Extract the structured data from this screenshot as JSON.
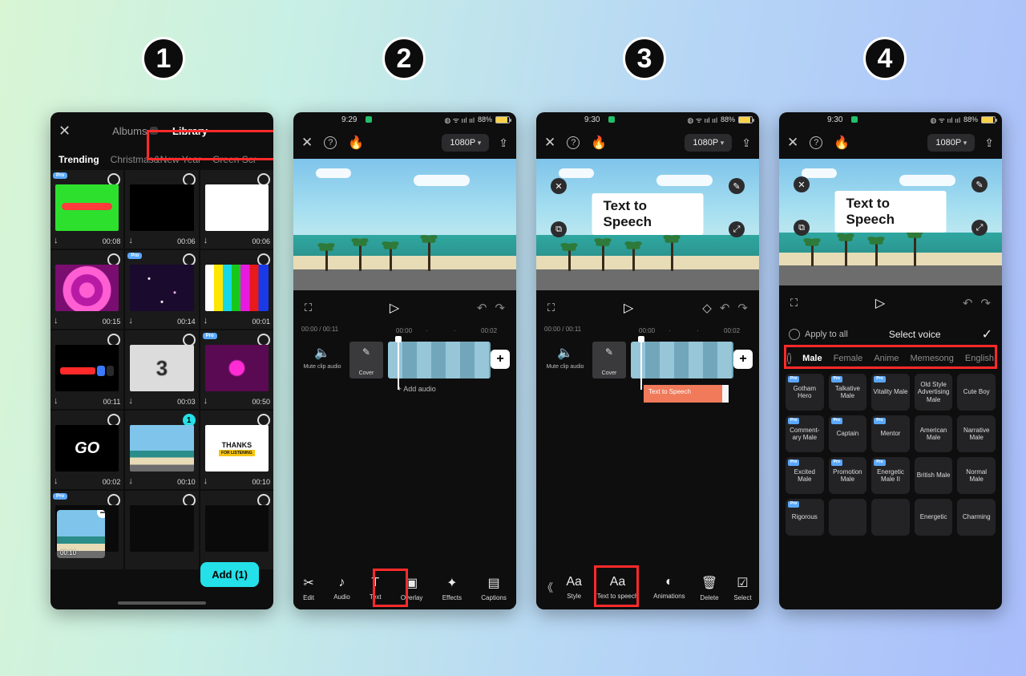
{
  "steps": [
    "1",
    "2",
    "3",
    "4"
  ],
  "phone1": {
    "close": "✕",
    "tab_albums": "Albums",
    "tab_albums_badge": "▸",
    "tab_library": "Library",
    "chips": [
      "Trending",
      "Christmas&New Year",
      "Green Scr"
    ],
    "grid": [
      {
        "pro": true,
        "dl": "↓",
        "dur": "00:08",
        "thumb": "th-green"
      },
      {
        "pro": false,
        "dl": "↓",
        "dur": "00:06",
        "thumb": "th-black"
      },
      {
        "pro": false,
        "dl": "↓",
        "dur": "00:06",
        "thumb": "th-white"
      },
      {
        "pro": false,
        "dl": "↓",
        "dur": "00:15",
        "thumb": "th-hearts"
      },
      {
        "pro": true,
        "dl": "↓",
        "dur": "00:14",
        "thumb": "th-stars"
      },
      {
        "pro": false,
        "dl": "↓",
        "dur": "00:01",
        "thumb": "th-bars"
      },
      {
        "pro": false,
        "dl": "↓",
        "dur": "00:11",
        "thumb": "th-sub"
      },
      {
        "pro": false,
        "dl": "↓",
        "dur": "00:03",
        "thumb": "th-3"
      },
      {
        "pro": true,
        "dl": "↓",
        "dur": "00:50",
        "thumb": "th-hearts2"
      },
      {
        "pro": false,
        "dl": "↓",
        "dur": "00:02",
        "thumb": "th-go"
      },
      {
        "pro": false,
        "dl": "↓",
        "dur": "00:10",
        "thumb": "th-beach",
        "selected": true
      },
      {
        "pro": false,
        "dl": "↓",
        "dur": "00:10",
        "thumb": "th-thanks"
      },
      {
        "pro": true,
        "dl": "",
        "dur": "",
        "thumb": "th-dark"
      },
      {
        "pro": false,
        "dl": "",
        "dur": "",
        "thumb": "th-dark"
      },
      {
        "pro": false,
        "dl": "",
        "dur": "",
        "thumb": "th-dark"
      }
    ],
    "selected_dur": "00:10",
    "add_label": "Add (1)"
  },
  "editor_common": {
    "status_time_2": "9:29",
    "status_time_3": "9:30",
    "status_time_4": "9:30",
    "battery": "88%",
    "resolution_label": "1080P",
    "time_cur": "00:00",
    "time_total": "00:11",
    "tick1": "00:00",
    "tick2": "00:02",
    "mute_label": "Mute clip audio",
    "cover_label": "Cover",
    "add_audio": "Add audio",
    "overlay_text": "Text to Speech",
    "tts_clip": "Text to Speech"
  },
  "toolbar2": [
    {
      "ic": "✂",
      "lb": "Edit"
    },
    {
      "ic": "♪",
      "lb": "Audio"
    },
    {
      "ic": "T",
      "lb": "Text"
    },
    {
      "ic": "▣",
      "lb": "Overlay"
    },
    {
      "ic": "✦",
      "lb": "Effects"
    },
    {
      "ic": "▤",
      "lb": "Captions"
    }
  ],
  "toolbar3": [
    {
      "ic": "Aa",
      "lb": "Style"
    },
    {
      "ic": "Aa",
      "lb": "Text to speech"
    },
    {
      "ic": "◐",
      "lb": "Animations"
    },
    {
      "ic": "🗑",
      "lb": "Delete"
    },
    {
      "ic": "☑",
      "lb": "Select"
    }
  ],
  "voice": {
    "apply": "Apply to all",
    "title": "Select voice",
    "cats": [
      "Male",
      "Female",
      "Anime",
      "Memesong",
      "English"
    ],
    "cells": [
      {
        "pro": true,
        "l": "Gotham Hero"
      },
      {
        "pro": true,
        "l": "Talkative Male"
      },
      {
        "pro": true,
        "l": "Vitality Male"
      },
      {
        "pro": false,
        "l": "Old Style Advertising Male"
      },
      {
        "pro": false,
        "l": "Cute Boy"
      },
      {
        "pro": true,
        "l": "Comment-ary Male"
      },
      {
        "pro": true,
        "l": "Captain"
      },
      {
        "pro": true,
        "l": "Mentor"
      },
      {
        "pro": false,
        "l": "American Male"
      },
      {
        "pro": false,
        "l": "Narrative Male"
      },
      {
        "pro": true,
        "l": "Excited Male"
      },
      {
        "pro": true,
        "l": "Promotion Male"
      },
      {
        "pro": true,
        "l": "Energetic Male II"
      },
      {
        "pro": false,
        "l": "British Male"
      },
      {
        "pro": false,
        "l": "Normal Male"
      },
      {
        "pro": true,
        "l": "Rigorous"
      },
      {
        "pro": false,
        "l": ""
      },
      {
        "pro": false,
        "l": ""
      },
      {
        "pro": false,
        "l": "Energetic"
      },
      {
        "pro": false,
        "l": "Charming"
      }
    ]
  }
}
